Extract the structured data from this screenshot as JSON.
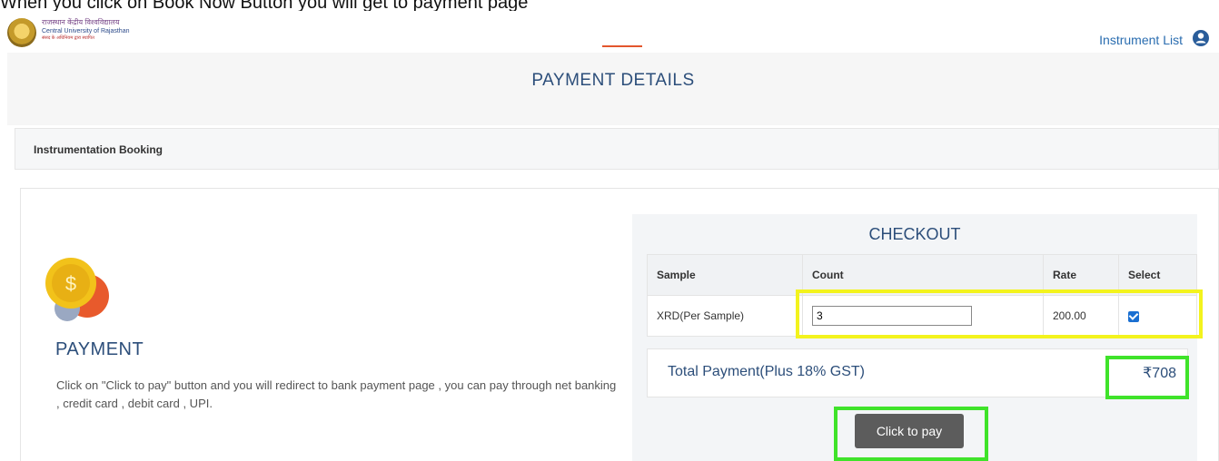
{
  "caption": "When you click on Book Now Button you will get to payment page",
  "header": {
    "logo_line1": "राजस्थान केंद्रीय विश्वविद्यालय",
    "logo_line2": "Central University of Rajasthan",
    "logo_line3": "संसद के अधिनियम द्वारा स्थापित",
    "nav_instrument_list": "Instrument List",
    "user_icon": "user-circle-icon"
  },
  "hero": {
    "title": "PAYMENT DETAILS",
    "accent": "#e3562d"
  },
  "booking": {
    "label": "Instrumentation Booking"
  },
  "payment": {
    "icon": "coin-icon",
    "coin_label": "$",
    "title": "PAYMENT",
    "description": "Click on \"Click to pay\" button and you will redirect to bank payment page , you can pay through net banking , credit card , debit card , UPI."
  },
  "checkout": {
    "title": "CHECKOUT",
    "columns": [
      "Sample",
      "Count",
      "Rate",
      "Select"
    ],
    "rows": [
      {
        "sample": "XRD(Per Sample)",
        "count": "3",
        "rate": "200.00",
        "selected": true
      }
    ],
    "total_label": "Total Payment(Plus 18% GST)",
    "total_amount": "₹708",
    "pay_button": "Click to pay"
  },
  "annotations": {
    "yellow": "#f3f31d",
    "green": "#3fe32a"
  }
}
